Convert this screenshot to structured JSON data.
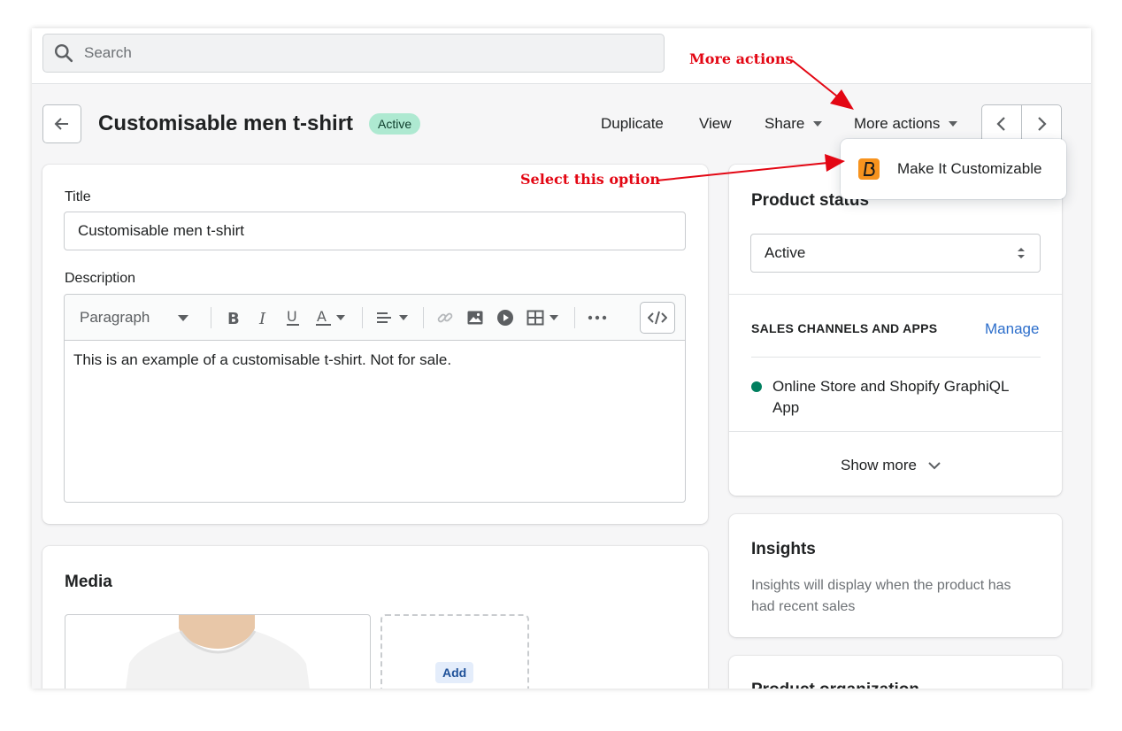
{
  "search": {
    "placeholder": "Search"
  },
  "header": {
    "title": "Customisable men t-shirt",
    "status_badge": "Active",
    "actions": {
      "duplicate": "Duplicate",
      "view": "View",
      "share": "Share",
      "more": "More actions"
    }
  },
  "more_actions_menu": {
    "items": [
      {
        "label": "Make It Customizable",
        "icon": "app-logo-icon"
      }
    ]
  },
  "main": {
    "title_label": "Title",
    "title_value": "Customisable men t-shirt",
    "description_label": "Description",
    "editor": {
      "paragraph_select": "Paragraph",
      "tools": [
        "bold-icon",
        "italic-icon",
        "underline-icon",
        "text-color-icon",
        "align-icon",
        "link-icon",
        "image-icon",
        "video-icon",
        "table-icon",
        "more-icon",
        "code-icon"
      ],
      "content": "This is an example of a customisable t-shirt. Not for sale."
    },
    "media": {
      "title": "Media",
      "add_label": "Add"
    }
  },
  "sidebar": {
    "status": {
      "title": "Product status",
      "value": "Active"
    },
    "channels": {
      "title": "SALES CHANNELS AND APPS",
      "manage": "Manage",
      "items": [
        "Online Store and Shopify GraphiQL App"
      ],
      "show_more": "Show more"
    },
    "insights": {
      "title": "Insights",
      "text": "Insights will display when the product has had recent sales"
    },
    "organization": {
      "title": "Product organization"
    }
  },
  "annotations": {
    "more_actions": "More actions",
    "select_option": "Select this option"
  },
  "colors": {
    "annotation": "#e30613",
    "badge_bg": "#aee9d1",
    "link": "#2c6ecb",
    "channel_dot": "#007f5f"
  }
}
